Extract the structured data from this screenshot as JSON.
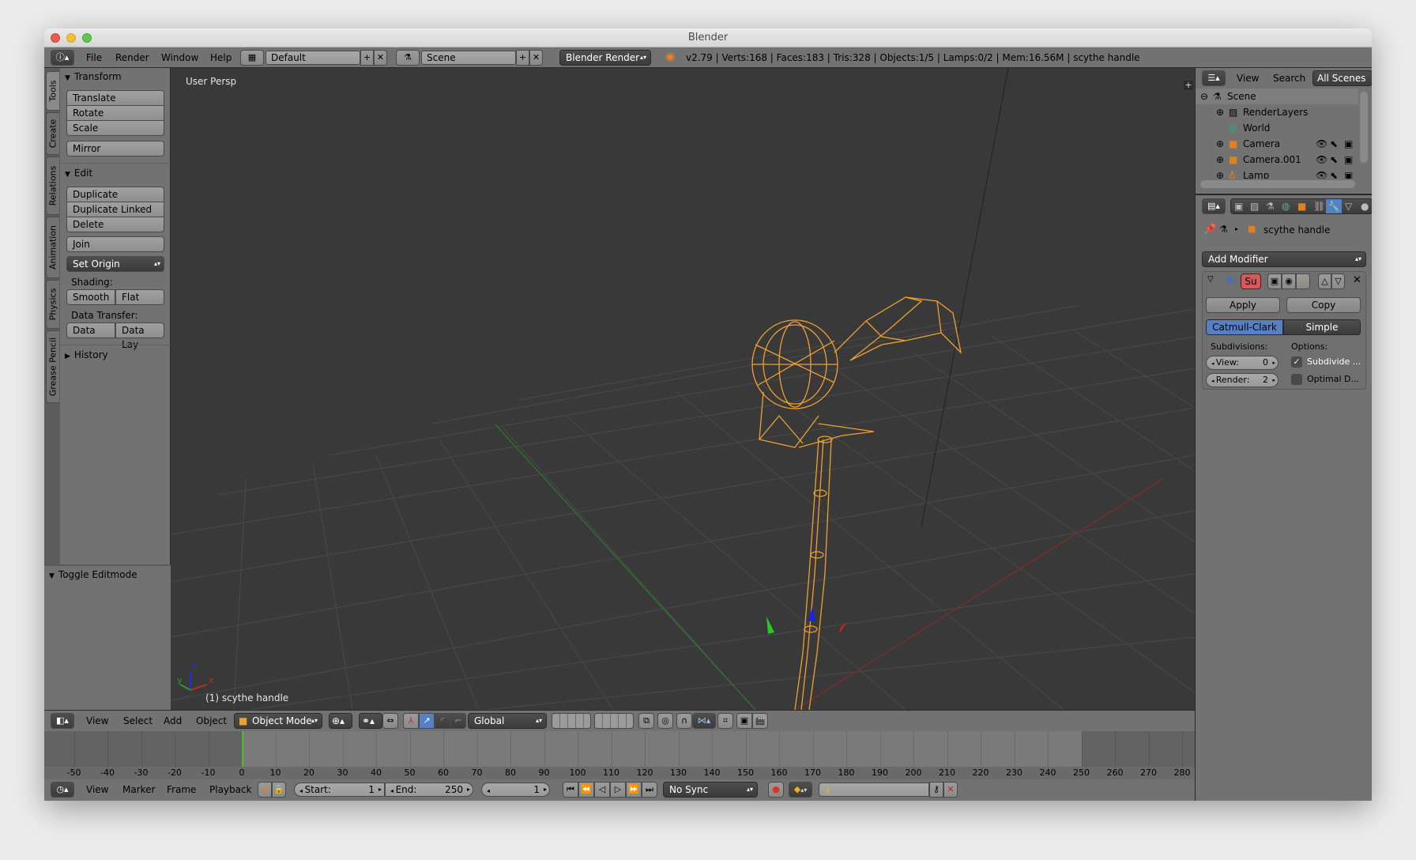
{
  "window": {
    "title": "Blender",
    "traffic_lights": {
      "close": "#ee5b52",
      "minimize": "#f6bd3b",
      "maximize": "#61c554"
    }
  },
  "info_header": {
    "editor_icon": "info-icon",
    "menus": [
      "File",
      "Render",
      "Window",
      "Help"
    ],
    "screen_layout": "Default",
    "scene": "Scene",
    "render_engine": "Blender Render",
    "stats": "v2.79 | Verts:168 | Faces:183 | Tris:328 | Objects:1/5 | Lamps:0/2 | Mem:16.56M | scythe handle"
  },
  "tool_shelf": {
    "tabs": [
      "Tools",
      "Create",
      "Relations",
      "Animation",
      "Physics",
      "Grease Pencil"
    ],
    "active_tab": "Tools",
    "transform": {
      "title": "Transform",
      "buttons": [
        "Translate",
        "Rotate",
        "Scale"
      ],
      "mirror": "Mirror"
    },
    "edit": {
      "title": "Edit",
      "buttons": [
        "Duplicate",
        "Duplicate Linked",
        "Delete"
      ],
      "join": "Join",
      "set_origin": "Set Origin",
      "shading_label": "Shading:",
      "shading": [
        "Smooth",
        "Flat"
      ],
      "data_transfer_label": "Data Transfer:",
      "data_transfer": [
        "Data",
        "Data Lay"
      ]
    },
    "history": {
      "title": "History"
    },
    "operator_panel": {
      "title": "Toggle Editmode"
    }
  },
  "viewport": {
    "view_label": "User Persp",
    "object_label": "(1) scythe handle",
    "axis_labels": {
      "x": "x",
      "y": "y",
      "z": "z"
    },
    "colors": {
      "background": "#393939",
      "grid": "#4a4a4a",
      "wire": "#f0a030",
      "x_axis": "#c22a2a",
      "y_axis": "#2e8b2e",
      "z_axis": "#2030e0"
    }
  },
  "view3d_header": {
    "menus": [
      "View",
      "Select",
      "Add",
      "Object"
    ],
    "mode": "Object Mode",
    "transform_orientation": "Global"
  },
  "timeline": {
    "ruler_ticks": [
      "-50",
      "-40",
      "-30",
      "-20",
      "-10",
      "0",
      "10",
      "20",
      "30",
      "40",
      "50",
      "60",
      "70",
      "80",
      "90",
      "100",
      "110",
      "120",
      "130",
      "140",
      "150",
      "160",
      "170",
      "180",
      "190",
      "200",
      "210",
      "220",
      "230",
      "240",
      "250",
      "260",
      "270",
      "280"
    ],
    "current_frame_marker": 0,
    "menus": [
      "View",
      "Marker",
      "Frame",
      "Playback"
    ],
    "start_label": "Start:",
    "start": "1",
    "end_label": "End:",
    "end": "250",
    "current_frame": "1",
    "sync": "No Sync"
  },
  "outliner": {
    "menus": [
      "View",
      "Search"
    ],
    "filter": "All Scenes",
    "items": [
      {
        "name": "Scene",
        "icon": "scene-icon"
      },
      {
        "name": "RenderLayers",
        "icon": "render-layers-icon"
      },
      {
        "name": "World",
        "icon": "world-icon"
      },
      {
        "name": "Camera",
        "icon": "camera-object-icon"
      },
      {
        "name": "Camera.001",
        "icon": "camera-object-icon"
      },
      {
        "name": "Lamp",
        "icon": "lamp-object-icon"
      }
    ]
  },
  "properties": {
    "breadcrumb_object": "scythe handle",
    "add_modifier": "Add Modifier",
    "modifier": {
      "short_name": "Su",
      "apply": "Apply",
      "copy": "Copy",
      "algorithms": [
        "Catmull-Clark",
        "Simple"
      ],
      "active_algorithm": "Catmull-Clark",
      "subdivisions_label": "Subdivisions:",
      "view_label": "View:",
      "view_value": "0",
      "render_label": "Render:",
      "render_value": "2",
      "options_label": "Options:",
      "subdivide_uvs": "Subdivide ...",
      "subdivide_uvs_checked": true,
      "optimal_display": "Optimal D...",
      "optimal_display_checked": false
    },
    "accent": "#5680c2"
  }
}
